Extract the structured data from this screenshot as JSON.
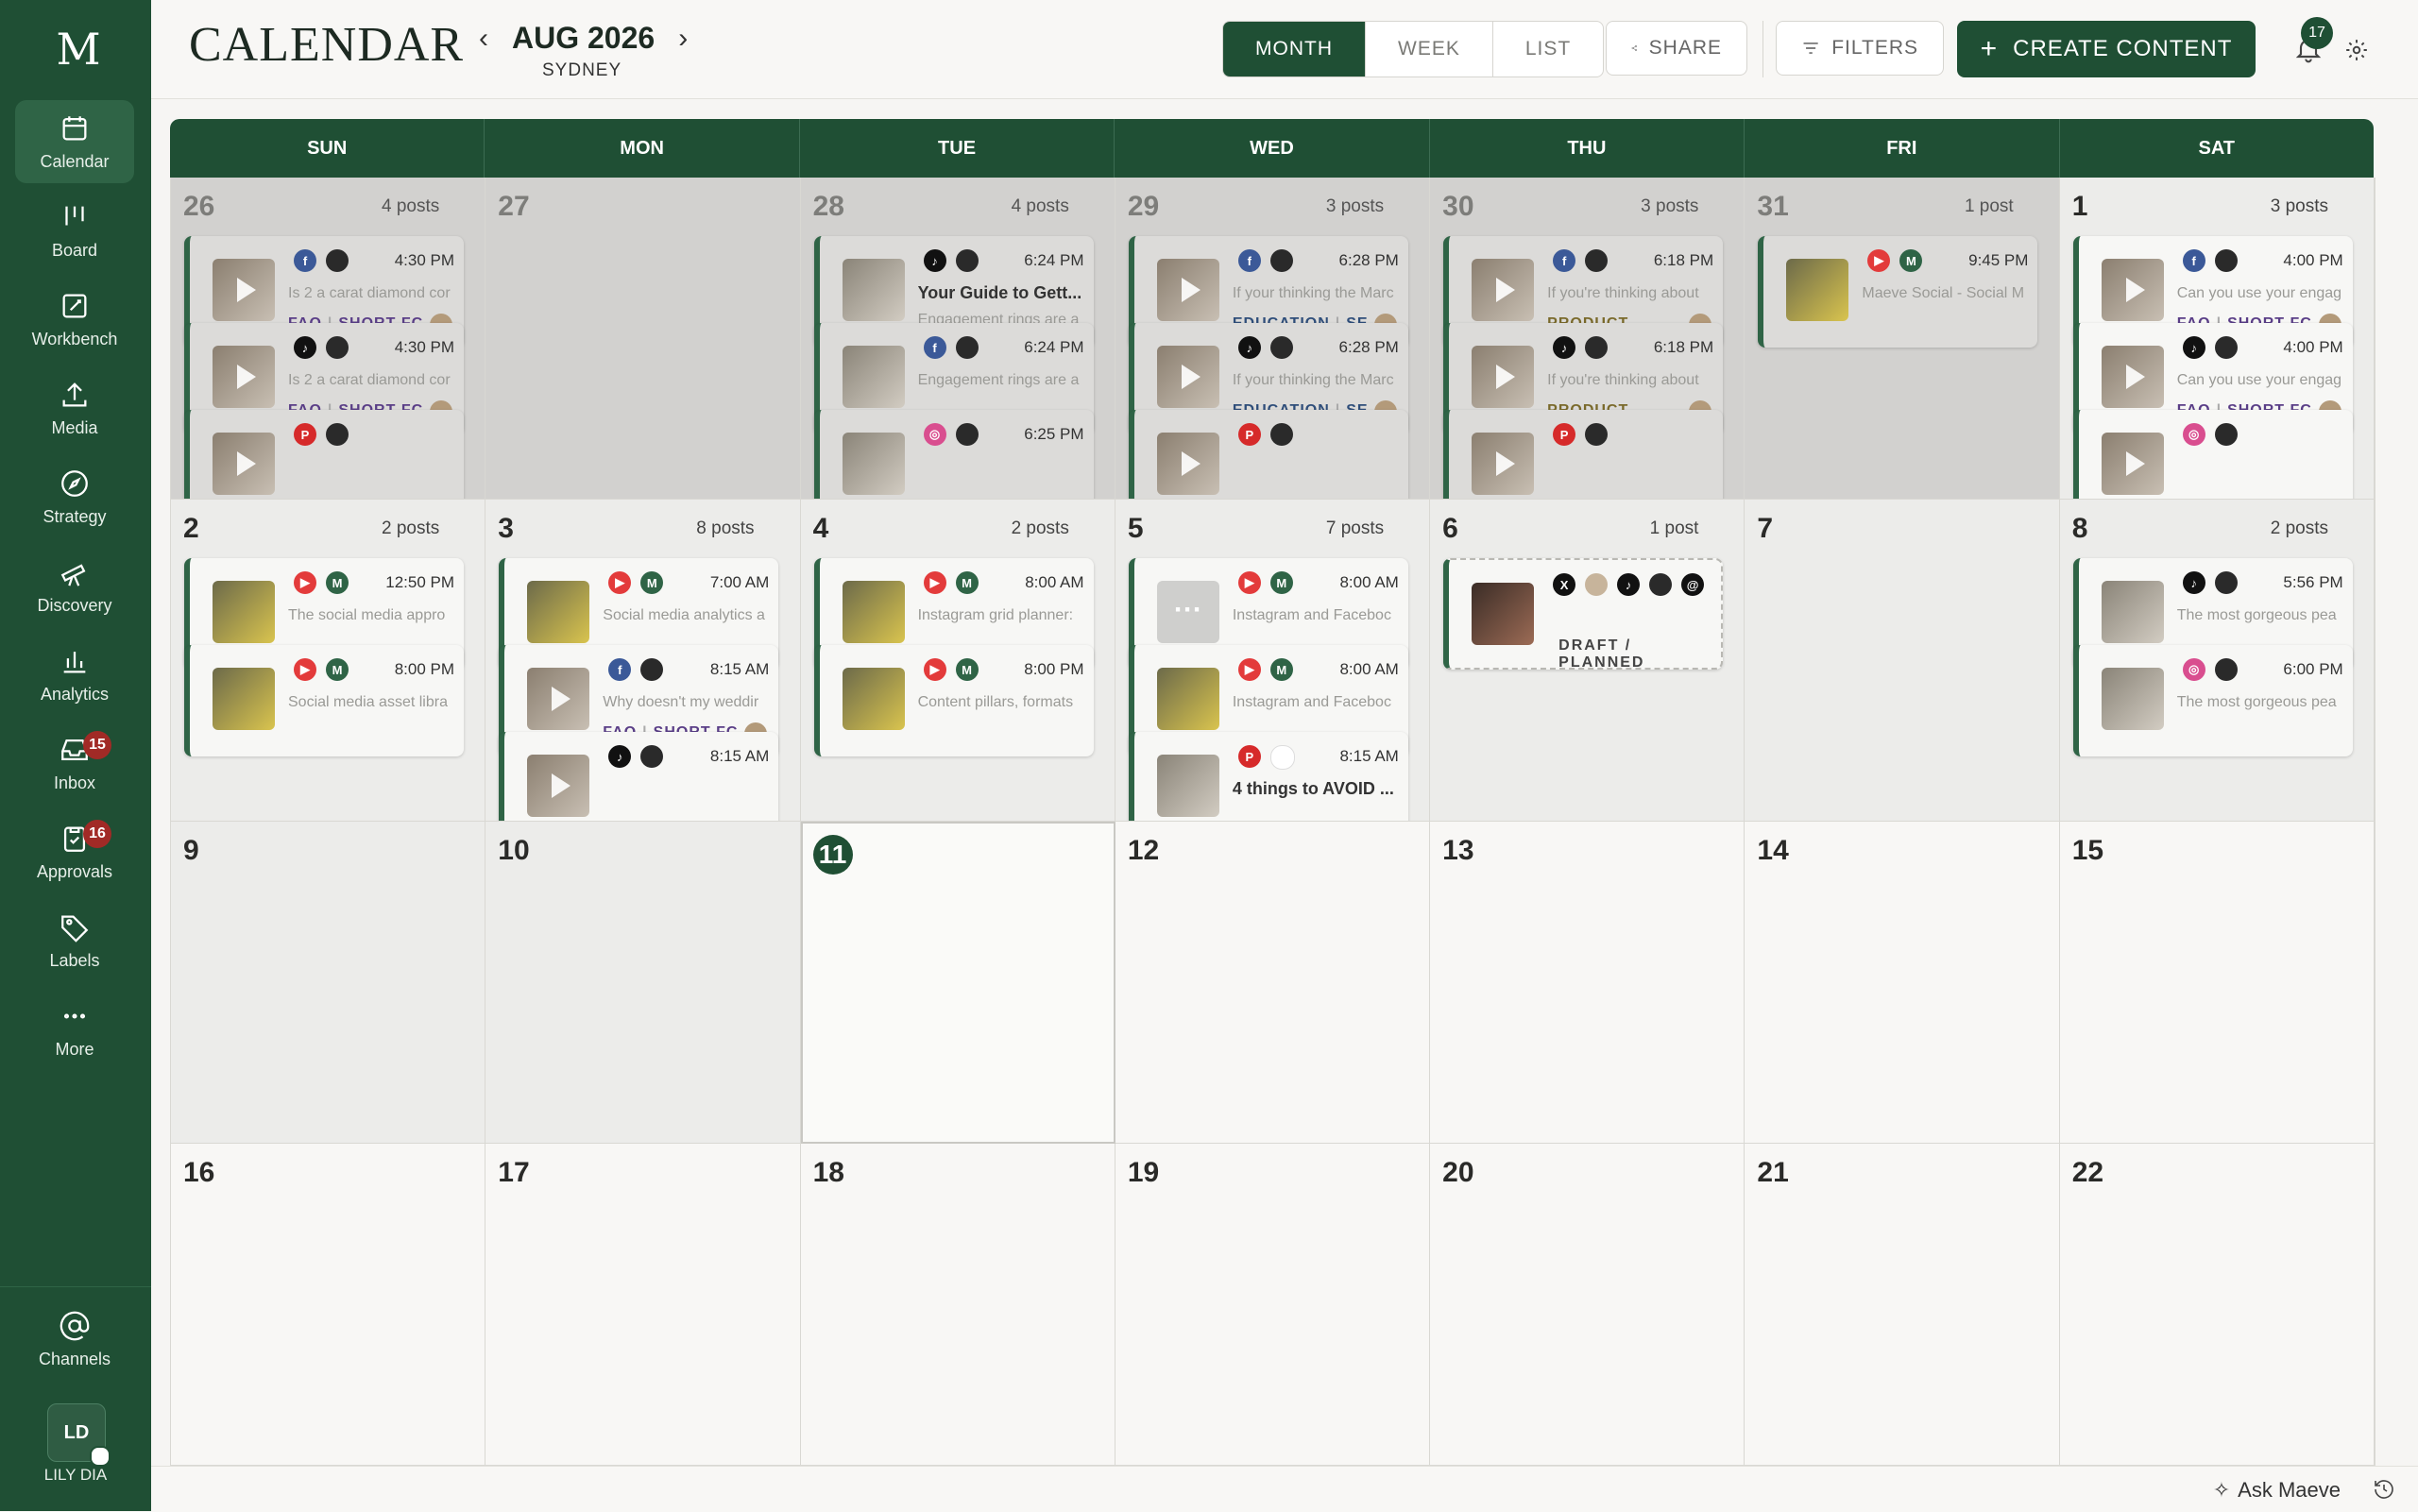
{
  "app": {
    "logo": "M",
    "title": "CALENDAR"
  },
  "nav": [
    {
      "label": "Calendar",
      "icon": "calendar-icon",
      "active": true
    },
    {
      "label": "Board",
      "icon": "board-icon"
    },
    {
      "label": "Workbench",
      "icon": "workbench-icon"
    },
    {
      "label": "Media",
      "icon": "upload-icon"
    },
    {
      "label": "Strategy",
      "icon": "compass-icon"
    },
    {
      "label": "Discovery",
      "icon": "telescope-icon"
    },
    {
      "label": "Analytics",
      "icon": "chart-icon"
    },
    {
      "label": "Inbox",
      "icon": "inbox-icon",
      "badge": "15"
    },
    {
      "label": "Approvals",
      "icon": "clipboard-icon",
      "badge": "16"
    },
    {
      "label": "Labels",
      "icon": "tag-icon"
    },
    {
      "label": "More",
      "icon": "more-icon"
    }
  ],
  "channels": {
    "label": "Channels"
  },
  "user": {
    "initials": "LD",
    "name": "LILY DIA"
  },
  "header": {
    "month": "AUG 2026",
    "timezone": "SYDNEY",
    "views": [
      "MONTH",
      "WEEK",
      "LIST"
    ],
    "active_view": "MONTH",
    "share": "SHARE",
    "filters": "FILTERS",
    "create": "CREATE CONTENT",
    "notifications": "17"
  },
  "weekdays": [
    "SUN",
    "MON",
    "TUE",
    "WED",
    "THU",
    "FRI",
    "SAT"
  ],
  "weeks": [
    [
      {
        "day": "26",
        "count": "4 posts",
        "state": "prev",
        "posts": [
          {
            "icons": [
              "fb",
              "av"
            ],
            "time": "4:30 PM",
            "snippet": "Is 2 a carat diamond cor",
            "tags": [
              "FAQ",
              "SHORT-FC"
            ],
            "thumb": "play",
            "avatar": true
          },
          {
            "icons": [
              "tt",
              "av"
            ],
            "time": "4:30 PM",
            "snippet": "Is 2 a carat diamond cor",
            "tags": [
              "FAQ",
              "SHORT-FC"
            ],
            "thumb": "play",
            "avatar": true
          },
          {
            "icons": [
              "pin",
              "av"
            ],
            "time": "",
            "snippet": "",
            "thumb": "play"
          }
        ]
      },
      {
        "day": "27",
        "count": "",
        "state": "prev",
        "posts": []
      },
      {
        "day": "28",
        "count": "4 posts",
        "state": "prev",
        "posts": [
          {
            "icons": [
              "tt",
              "av"
            ],
            "time": "6:24 PM",
            "title": "Your Guide to Gett...",
            "snippet": "Engagement rings are a",
            "thumb": "hand"
          },
          {
            "icons": [
              "fb",
              "av"
            ],
            "time": "6:24 PM",
            "snippet": "Engagement rings are a",
            "thumb": "hand"
          },
          {
            "icons": [
              "ig",
              "av"
            ],
            "time": "6:25 PM",
            "snippet": "",
            "thumb": "hand"
          }
        ]
      },
      {
        "day": "29",
        "count": "3 posts",
        "state": "prev",
        "posts": [
          {
            "icons": [
              "fb",
              "av"
            ],
            "time": "6:28 PM",
            "snippet": "If your thinking the Marc",
            "tags": [
              "EDUCATION",
              "SE"
            ],
            "thumb": "play",
            "avatar": true,
            "tagstyle": "edu"
          },
          {
            "icons": [
              "tt",
              "av"
            ],
            "time": "6:28 PM",
            "snippet": "If your thinking the Marc",
            "tags": [
              "EDUCATION",
              "SE"
            ],
            "thumb": "play",
            "avatar": true,
            "tagstyle": "edu"
          },
          {
            "icons": [
              "pin",
              "av"
            ],
            "time": "",
            "snippet": "",
            "thumb": "play"
          }
        ]
      },
      {
        "day": "30",
        "count": "3 posts",
        "state": "prev",
        "posts": [
          {
            "icons": [
              "fb",
              "av"
            ],
            "time": "6:18 PM",
            "snippet": "If you're thinking about",
            "tags": [
              "PRODUCT"
            ],
            "thumb": "play",
            "avatar": true,
            "tagstyle": "prod"
          },
          {
            "icons": [
              "tt",
              "av"
            ],
            "time": "6:18 PM",
            "snippet": "If you're thinking about",
            "tags": [
              "PRODUCT"
            ],
            "thumb": "play",
            "avatar": true,
            "tagstyle": "prod"
          },
          {
            "icons": [
              "pin",
              "av"
            ],
            "time": "",
            "snippet": "",
            "thumb": "play"
          }
        ]
      },
      {
        "day": "31",
        "count": "1 post",
        "state": "prev",
        "posts": [
          {
            "icons": [
              "yt",
              "ma"
            ],
            "time": "9:45 PM",
            "snippet": "Maeve Social - Social M",
            "thumb": "yellow"
          }
        ]
      },
      {
        "day": "1",
        "count": "3 posts",
        "state": "past",
        "posts": [
          {
            "icons": [
              "fb",
              "av"
            ],
            "time": "4:00 PM",
            "snippet": "Can you use your engag",
            "tags": [
              "FAQ",
              "SHORT-FC"
            ],
            "thumb": "play",
            "avatar": true
          },
          {
            "icons": [
              "tt",
              "av"
            ],
            "time": "4:00 PM",
            "snippet": "Can you use your engag",
            "tags": [
              "FAQ",
              "SHORT-FC"
            ],
            "thumb": "play",
            "avatar": true
          },
          {
            "icons": [
              "ig",
              "av"
            ],
            "time": "",
            "snippet": "",
            "thumb": "play"
          }
        ]
      }
    ],
    [
      {
        "day": "2",
        "count": "2 posts",
        "state": "past",
        "posts": [
          {
            "icons": [
              "yt",
              "ma"
            ],
            "time": "12:50 PM",
            "snippet": "The social media appro",
            "thumb": "yellow"
          },
          {
            "icons": [
              "yt",
              "ma"
            ],
            "time": "8:00 PM",
            "snippet": "Social media asset libra",
            "thumb": "yellow"
          }
        ]
      },
      {
        "day": "3",
        "count": "8 posts",
        "state": "past",
        "posts": [
          {
            "icons": [
              "yt",
              "ma"
            ],
            "time": "7:00 AM",
            "snippet": "Social media analytics a",
            "thumb": "yellow"
          },
          {
            "icons": [
              "fb",
              "av"
            ],
            "time": "8:15 AM",
            "snippet": "Why doesn't my weddir",
            "tags": [
              "FAQ",
              "SHORT-FC"
            ],
            "thumb": "play",
            "avatar": true
          },
          {
            "icons": [
              "tt",
              "av"
            ],
            "time": "8:15 AM",
            "snippet": "",
            "thumb": "play"
          }
        ]
      },
      {
        "day": "4",
        "count": "2 posts",
        "state": "past",
        "posts": [
          {
            "icons": [
              "yt",
              "ma"
            ],
            "time": "8:00 AM",
            "snippet": "Instagram grid planner:",
            "thumb": "yellow"
          },
          {
            "icons": [
              "yt",
              "ma"
            ],
            "time": "8:00 PM",
            "snippet": "Content pillars, formats",
            "thumb": "yellow"
          }
        ]
      },
      {
        "day": "5",
        "count": "7 posts",
        "state": "past",
        "posts": [
          {
            "icons": [
              "yt",
              "ma"
            ],
            "time": "8:00 AM",
            "snippet": "Instagram and Faceboc",
            "thumb": "grey"
          },
          {
            "icons": [
              "yt",
              "ma"
            ],
            "time": "8:00 AM",
            "snippet": "Instagram and Faceboc",
            "thumb": "yellow"
          },
          {
            "icons": [
              "pin",
              "wh"
            ],
            "time": "8:15 AM",
            "title": "4 things to AVOID ...",
            "snippet": "",
            "thumb": "hand"
          }
        ]
      },
      {
        "day": "6",
        "count": "1 post",
        "state": "past",
        "posts": [
          {
            "icons": [
              "x",
              "pf",
              "tt",
              "av",
              "th"
            ],
            "time": "",
            "draft": "DRAFT / PLANNED",
            "thumb": "dark"
          }
        ]
      },
      {
        "day": "7",
        "count": "",
        "state": "past",
        "posts": []
      },
      {
        "day": "8",
        "count": "2 posts",
        "state": "past",
        "posts": [
          {
            "icons": [
              "tt",
              "av"
            ],
            "time": "5:56 PM",
            "snippet": "The most gorgeous pea",
            "thumb": "hand"
          },
          {
            "icons": [
              "ig",
              "av"
            ],
            "time": "6:00 PM",
            "snippet": "The most gorgeous pea",
            "thumb": "hand"
          }
        ]
      }
    ],
    [
      {
        "day": "9",
        "count": "",
        "state": "past",
        "posts": []
      },
      {
        "day": "10",
        "count": "",
        "state": "past",
        "posts": []
      },
      {
        "day": "11",
        "count": "",
        "state": "today",
        "posts": []
      },
      {
        "day": "12",
        "count": "",
        "state": "future",
        "posts": []
      },
      {
        "day": "13",
        "count": "",
        "state": "future",
        "posts": []
      },
      {
        "day": "14",
        "count": "",
        "state": "future",
        "posts": []
      },
      {
        "day": "15",
        "count": "",
        "state": "future",
        "posts": []
      }
    ],
    [
      {
        "day": "16",
        "count": "",
        "state": "future",
        "posts": []
      },
      {
        "day": "17",
        "count": "",
        "state": "future",
        "posts": []
      },
      {
        "day": "18",
        "count": "",
        "state": "future",
        "posts": []
      },
      {
        "day": "19",
        "count": "",
        "state": "future",
        "posts": []
      },
      {
        "day": "20",
        "count": "",
        "state": "future",
        "posts": []
      },
      {
        "day": "21",
        "count": "",
        "state": "future",
        "posts": []
      },
      {
        "day": "22",
        "count": "",
        "state": "future",
        "posts": []
      }
    ]
  ],
  "assistant": {
    "label": "Ask Maeve"
  },
  "colors": {
    "brand": "#1f4f34",
    "brand_light": "#2f6446",
    "badge": "#a12a26"
  }
}
